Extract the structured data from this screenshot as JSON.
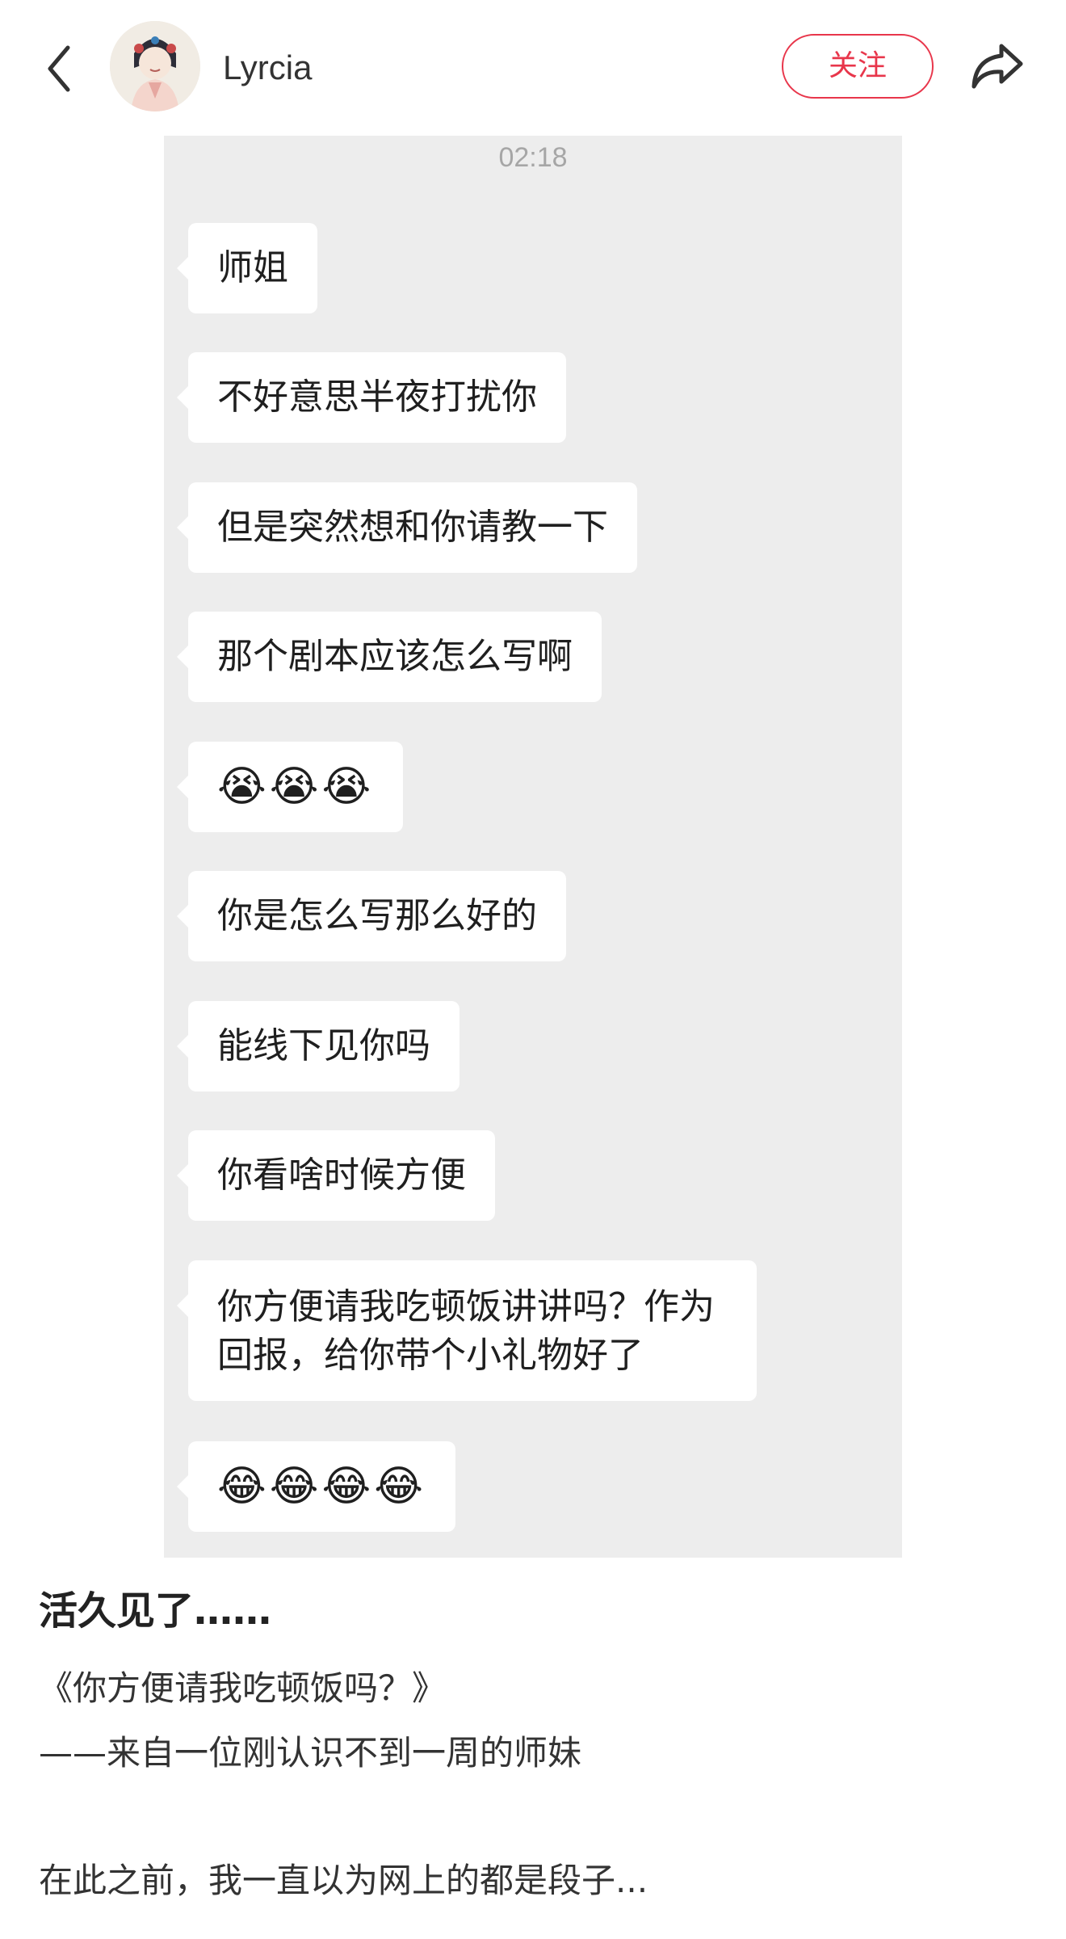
{
  "header": {
    "author_name": "Lyrcia",
    "follow_label": "关注",
    "icons": [
      "back-icon",
      "avatar",
      "share-icon"
    ],
    "accent_color": "#e8364b"
  },
  "chat": {
    "time": "02:18",
    "messages": [
      {
        "text": "师姐"
      },
      {
        "text": "不好意思半夜打扰你"
      },
      {
        "text": "但是突然想和你请教一下"
      },
      {
        "text": "那个剧本应该怎么写啊"
      },
      {
        "text": "😭😭😭"
      },
      {
        "text": "你是怎么写那么好的"
      },
      {
        "text": "能线下见你吗"
      },
      {
        "text": "你看啥时候方便"
      },
      {
        "text": "你方便请我吃顿饭讲讲吗？作为回报，给你带个小礼物好了"
      },
      {
        "text": "😂😂😂😂"
      }
    ]
  },
  "post": {
    "title": "活久见了……",
    "lines": [
      "《你方便请我吃顿饭吗？》",
      "——来自一位刚认识不到一周的师妹",
      "在此之前，我一直以为网上的都是段子..."
    ]
  }
}
